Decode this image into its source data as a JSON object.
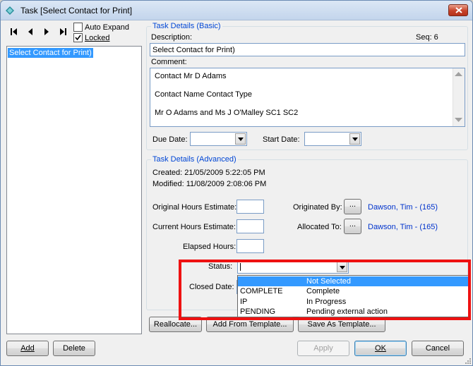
{
  "window": {
    "title": "Task  [Select Contact for Print]",
    "close_label": "X"
  },
  "left": {
    "auto_expand_label": "Auto Expand",
    "auto_expand_checked": false,
    "locked_label": "Locked",
    "locked_checked": true,
    "tree_item": "Select Contact for Print)"
  },
  "basic": {
    "group_title": "Task Details (Basic)",
    "description_label": "Description:",
    "seq_label": "Seq: 6",
    "description_value": "Select Contact for Print)",
    "comment_label": "Comment:",
    "comment_lines": [
      "Contact   Mr D Adams",
      "Contact Name          Contact Type",
      "Mr O Adams and Ms J O'Malley      SC1   SC2"
    ],
    "due_date_label": "Due Date:",
    "start_date_label": "Start Date:"
  },
  "advanced": {
    "group_title": "Task Details (Advanced)",
    "created": "Created: 21/05/2009 5:22:05 PM",
    "modified": "Modified: 11/08/2009 2:08:06 PM",
    "original_hours_label": "Original Hours Estimate:",
    "current_hours_label": "Current Hours Estimate:",
    "elapsed_hours_label": "Elapsed Hours:",
    "originated_by_label": "Originated By:",
    "allocated_to_label": "Allocated To:",
    "browse_label": "...",
    "originated_by_value": "Dawson, Tim - (165)",
    "allocated_to_value": "Dawson, Tim - (165)",
    "status_label": "Status:",
    "closed_date_label": "Closed Date:",
    "status_options": [
      {
        "code": "",
        "desc": "Not Selected",
        "selected": true
      },
      {
        "code": "COMPLETE",
        "desc": "Complete",
        "selected": false
      },
      {
        "code": "IP",
        "desc": "In Progress",
        "selected": false
      },
      {
        "code": "PENDING",
        "desc": "Pending external action",
        "selected": false
      }
    ],
    "reallocate_label": "Reallocate...",
    "add_template_label": "Add From Template...",
    "save_template_label": "Save As Template..."
  },
  "footer": {
    "add_label": "Add",
    "delete_label": "Delete",
    "apply_label": "Apply",
    "ok_label": "OK",
    "cancel_label": "Cancel"
  },
  "colors": {
    "highlight": "#ee1111",
    "selection": "#3399ff",
    "link": "#0033cc"
  }
}
